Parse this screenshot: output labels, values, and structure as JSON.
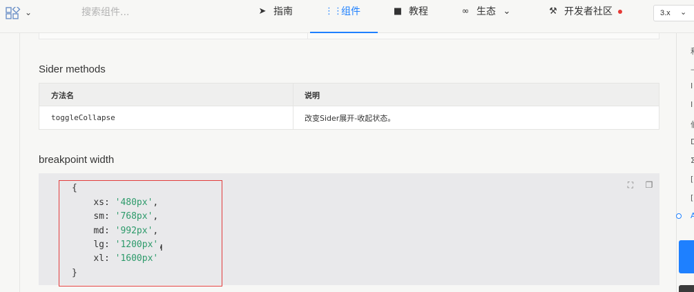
{
  "header": {
    "search_placeholder": "搜索组件...",
    "nav": [
      {
        "label": "指南",
        "icon": "compass-icon"
      },
      {
        "label": "组件",
        "icon": "grid-icon",
        "active": true
      },
      {
        "label": "教程",
        "icon": "video-icon"
      },
      {
        "label": "生态",
        "icon": "infinity-icon"
      },
      {
        "label": "开发者社区",
        "icon": "tools-icon"
      }
    ],
    "version": "3.x"
  },
  "sections": {
    "methods_title": "Sider methods",
    "breakpoint_title": "breakpoint width"
  },
  "methods_table": {
    "headers": [
      "方法名",
      "说明"
    ],
    "rows": [
      [
        "toggleCollapse",
        "改变Sider展开-收起状态。"
      ]
    ]
  },
  "code": {
    "open": "{",
    "entries": [
      {
        "key": "xs",
        "value": "'480px'",
        "suffix": ","
      },
      {
        "key": "sm",
        "value": "'768px'",
        "suffix": ","
      },
      {
        "key": "md",
        "value": "'992px'",
        "suffix": ","
      },
      {
        "key": "lg",
        "value": "'1200px'",
        "suffix": ","
      },
      {
        "key": "xl",
        "value": "'1600px'",
        "suffix": ""
      }
    ],
    "close": "}"
  },
  "right_rail": {
    "fragments": [
      "和",
      "—",
      "I",
      "I",
      "伯",
      "D",
      "Σ",
      "[",
      "[",
      "A"
    ]
  },
  "colors": {
    "accent": "#1e80ff",
    "code_string": "#2c9a6a",
    "highlight_border": "#e23b3b",
    "notification_dot": "#e53935"
  }
}
